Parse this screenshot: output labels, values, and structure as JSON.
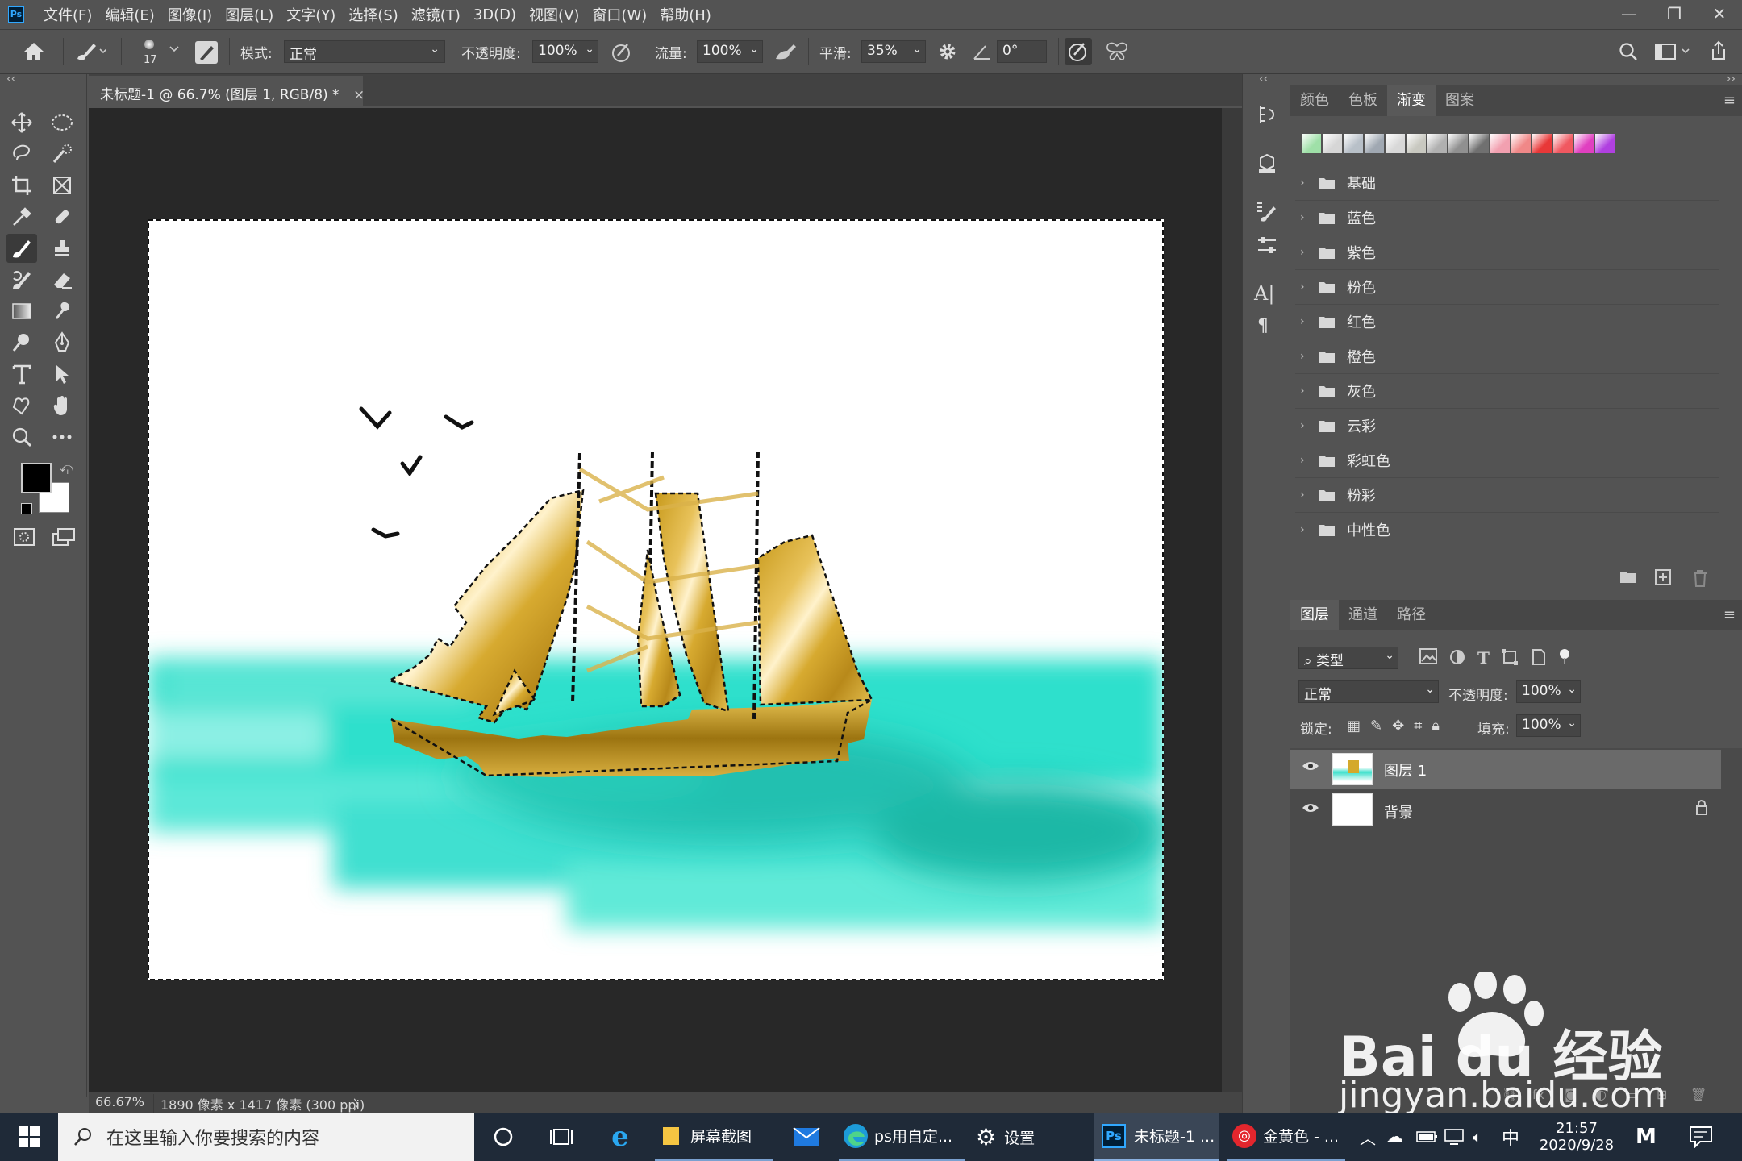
{
  "app_icon": "Ps",
  "menu": [
    "文件(F)",
    "编辑(E)",
    "图像(I)",
    "图层(L)",
    "文字(Y)",
    "选择(S)",
    "滤镜(T)",
    "3D(D)",
    "视图(V)",
    "窗口(W)",
    "帮助(H)"
  ],
  "window_controls": {
    "minimize": "—",
    "restore": "❐",
    "close": "✕"
  },
  "options": {
    "brush_size": "17",
    "mode_label": "模式:",
    "mode_value": "正常",
    "opacity_label": "不透明度:",
    "opacity_value": "100%",
    "flow_label": "流量:",
    "flow_value": "100%",
    "smooth_label": "平滑:",
    "smooth_value": "35%",
    "angle_value": "0°"
  },
  "document": {
    "tab_title": "未标题-1 @ 66.7% (图层 1, RGB/8) *",
    "close": "×",
    "zoom": "66.67%",
    "size_info": "1890 像素 x 1417 像素 (300 ppi)",
    "info_arrow": "〉"
  },
  "gradients_panel": {
    "tabs": [
      "颜色",
      "色板",
      "渐变",
      "图案"
    ],
    "active_tab": "渐变",
    "swatch_colors": [
      "#9fe0a8",
      "#d6d6d6",
      "#b8c0c8",
      "#a0a8b2",
      "#d8d8d8",
      "#c8c8c0",
      "#b0b0b0",
      "#909090",
      "#707070",
      "#f2a0b0",
      "#f08888",
      "#e83838",
      "#f05860",
      "#e040c0",
      "#b040e0"
    ],
    "groups": [
      "基础",
      "蓝色",
      "紫色",
      "粉色",
      "红色",
      "橙色",
      "灰色",
      "云彩",
      "彩虹色",
      "粉彩",
      "中性色"
    ]
  },
  "layers_panel": {
    "tabs": [
      "图层",
      "通道",
      "路径"
    ],
    "active_tab": "图层",
    "filter_label": "类型",
    "blend_mode": "正常",
    "opacity_label": "不透明度:",
    "opacity_value": "100%",
    "lock_label": "锁定:",
    "fill_label": "填充:",
    "fill_value": "100%",
    "layers": [
      {
        "name": "图层 1",
        "selected": true,
        "visible": true
      },
      {
        "name": "背景",
        "selected": false,
        "visible": true,
        "locked": true
      }
    ]
  },
  "taskbar": {
    "search_placeholder": "在这里输入你要搜索的内容",
    "apps": [
      "屏幕截图",
      "ps用自定...",
      "设置",
      "未标题-1 ...",
      "金黄色 - ..."
    ],
    "ime": "中",
    "time": "21:57",
    "date": "2020/9/28"
  },
  "watermark": {
    "text": "Bai du 经验",
    "url": "jingyan.baidu.com"
  }
}
